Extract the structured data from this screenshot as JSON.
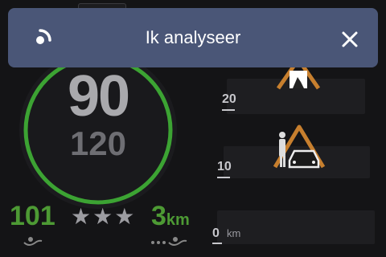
{
  "banner": {
    "title": "Ik analyseer",
    "status_icon": "analyzing-icon",
    "close_icon": "close-icon",
    "background": "#4a5677"
  },
  "speedometer": {
    "current_speed": "90",
    "speed_limit": "120",
    "ring_color": "#3ca333"
  },
  "stats": {
    "left_value": "101",
    "stars": "★★★",
    "distance_value": "3",
    "distance_unit": "km",
    "accent_color": "#4d9a34"
  },
  "alerts": [
    {
      "value": "20",
      "unit": "",
      "icon": "roadworks-warning-icon"
    },
    {
      "value": "10",
      "unit": "",
      "icon": "police-check-warning-icon"
    },
    {
      "value": "0",
      "unit": "km",
      "icon": ""
    }
  ]
}
